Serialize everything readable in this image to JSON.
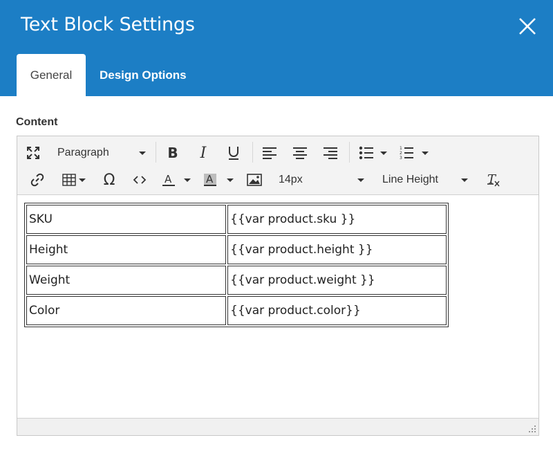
{
  "dialog": {
    "title": "Text Block Settings",
    "tabs": [
      {
        "label": "General",
        "active": true
      },
      {
        "label": "Design Options",
        "active": false
      }
    ]
  },
  "content": {
    "label": "Content"
  },
  "toolbar": {
    "block_format": "Paragraph",
    "font_size": "14px",
    "line_height": "Line Height",
    "icons": [
      "fullscreen-icon",
      "bold-icon",
      "italic-icon",
      "underline-icon",
      "align-left-icon",
      "align-center-icon",
      "align-right-icon",
      "bullet-list-icon",
      "numbered-list-icon",
      "link-icon",
      "table-icon",
      "special-char-icon",
      "source-code-icon",
      "text-color-icon",
      "background-color-icon",
      "image-icon",
      "clear-formatting-icon"
    ]
  },
  "table": {
    "rows": [
      [
        "SKU",
        "{{var product.sku }}"
      ],
      [
        "Height",
        "{{var product.height }}"
      ],
      [
        "Weight",
        "{{var product.weight }}"
      ],
      [
        "Color",
        "{{var product.color}}"
      ]
    ]
  },
  "colors": {
    "header_bg": "#1c7ec5",
    "toolbar_bg": "#f3f3f3"
  }
}
